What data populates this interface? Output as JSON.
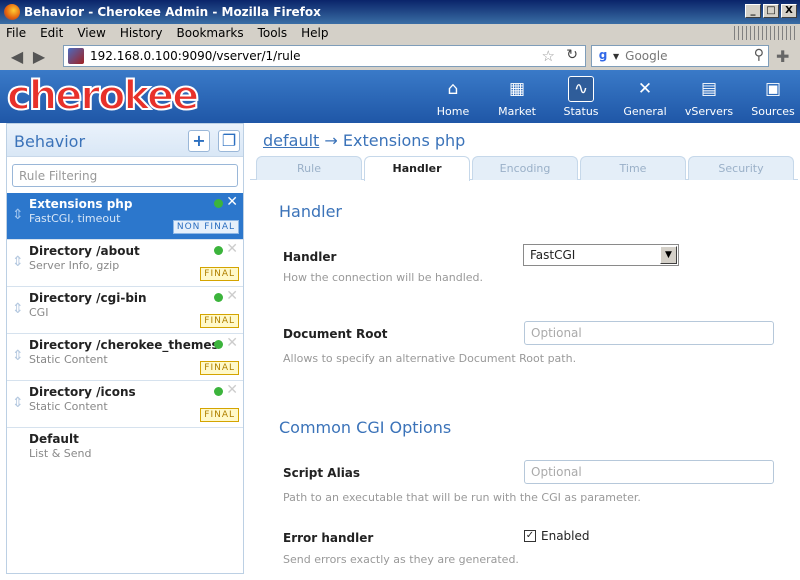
{
  "window": {
    "title": "Behavior - Cherokee Admin - Mozilla Firefox",
    "buttons": [
      "_",
      "□",
      "X"
    ]
  },
  "menu": [
    "File",
    "Edit",
    "View",
    "History",
    "Bookmarks",
    "Tools",
    "Help"
  ],
  "navigation": {
    "url": "192.168.0.100:9090/vserver/1/rule",
    "search_placeholder": "Google"
  },
  "header": {
    "logo": "cherokee",
    "nav": [
      {
        "label": "Home",
        "icon": "home-icon"
      },
      {
        "label": "Market",
        "icon": "market-icon"
      },
      {
        "label": "Status",
        "icon": "status-icon"
      },
      {
        "label": "General",
        "icon": "tools-icon"
      },
      {
        "label": "vServers",
        "icon": "vservers-icon"
      },
      {
        "label": "Sources",
        "icon": "sources-icon"
      }
    ]
  },
  "sidebar": {
    "title": "Behavior",
    "filter_placeholder": "Rule Filtering",
    "rules": [
      {
        "name": "Extensions php",
        "desc": "FastCGI, timeout",
        "badge": "NON FINAL"
      },
      {
        "name": "Directory /about",
        "desc": "Server Info, gzip",
        "badge": "FINAL"
      },
      {
        "name": "Directory /cgi-bin",
        "desc": "CGI",
        "badge": "FINAL"
      },
      {
        "name": "Directory /cherokee_themes",
        "desc": "Static Content",
        "badge": "FINAL"
      },
      {
        "name": "Directory /icons",
        "desc": "Static Content",
        "badge": "FINAL"
      },
      {
        "name": "Default",
        "desc": "List & Send",
        "badge": ""
      }
    ]
  },
  "breadcrumb": {
    "link": "default",
    "arrow": "→",
    "current": "Extensions php"
  },
  "tabs": [
    "Rule",
    "Handler",
    "Encoding",
    "Time",
    "Security"
  ],
  "content": {
    "section_handler": "Handler",
    "handler_label": "Handler",
    "handler_value": "FastCGI",
    "handler_hint": "How the connection will be handled.",
    "docroot_label": "Document Root",
    "docroot_placeholder": "Optional",
    "docroot_hint": "Allows to specify an alternative Document Root path.",
    "section_cgi": "Common CGI Options",
    "alias_label": "Script Alias",
    "alias_placeholder": "Optional",
    "alias_hint": "Path to an executable that will be run with the CGI as parameter.",
    "error_label": "Error handler",
    "error_checkbox": "Enabled",
    "error_hint": "Send errors exactly as they are generated."
  },
  "colors": {
    "accent": "#3b73b9",
    "header": "#1f57a7",
    "selected": "#2c77cc",
    "logo": "#e8312a"
  }
}
